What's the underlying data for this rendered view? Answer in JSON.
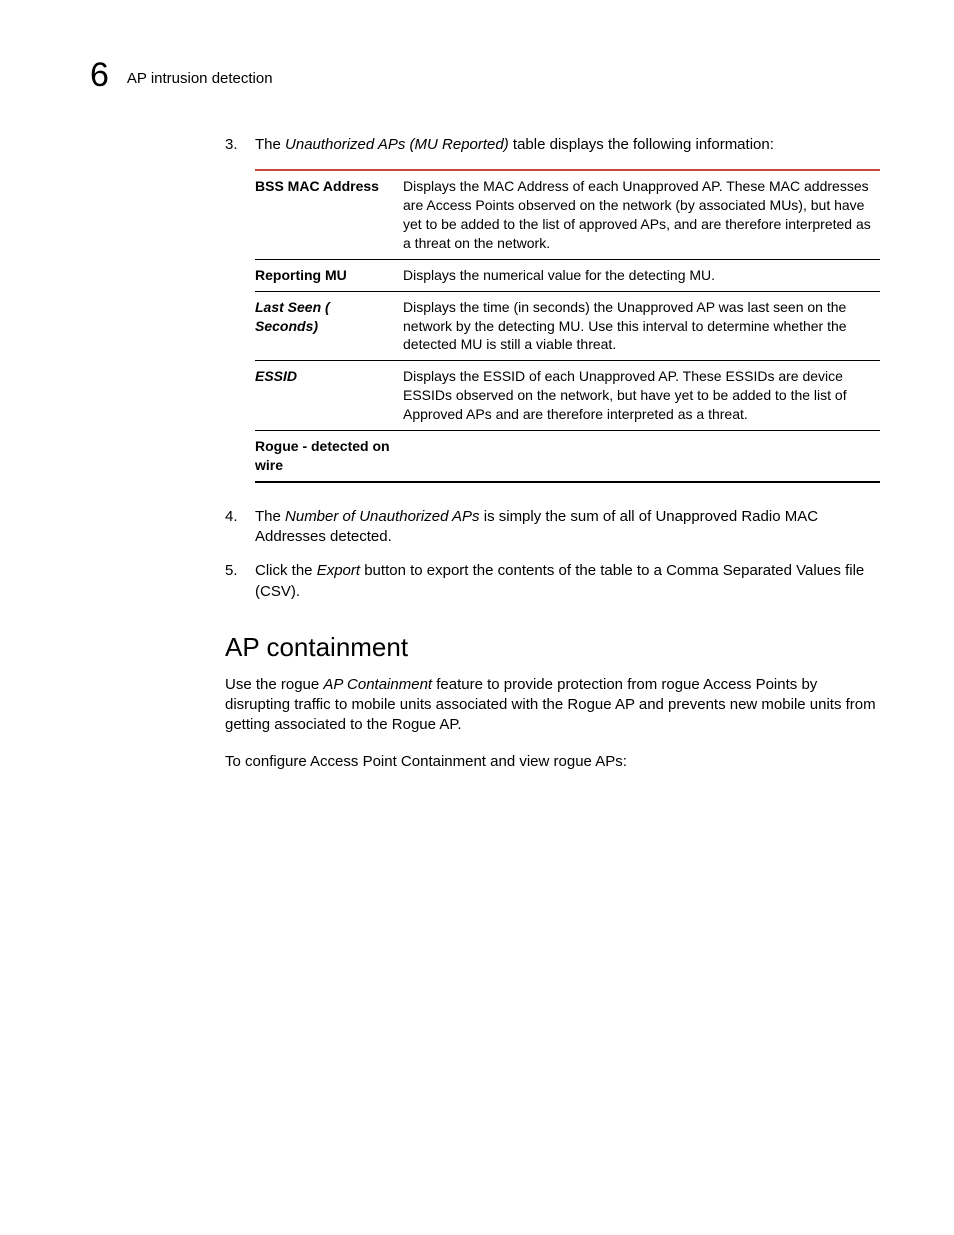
{
  "header": {
    "chapter": "6",
    "title": "AP intrusion detection"
  },
  "steps_a": [
    {
      "num": "3.",
      "pre": "The ",
      "ital": "Unauthorized APs (MU Reported)",
      "post": " table displays the following information:"
    }
  ],
  "table": [
    {
      "term": "BSS MAC Address",
      "term_italic": false,
      "desc": "Displays the MAC Address of each Unapproved AP. These MAC addresses are Access Points observed on the network (by associated MUs), but have yet to be added to the list of approved APs, and are therefore interpreted as a threat on the network."
    },
    {
      "term": "Reporting MU",
      "term_italic": false,
      "desc": "Displays the numerical value for the detecting MU."
    },
    {
      "term": "Last Seen ( Seconds)",
      "term_italic": true,
      "desc": "Displays the time (in seconds) the Unapproved AP was last seen on the network by the detecting MU. Use this interval to determine whether the detected MU is still a viable threat."
    },
    {
      "term": "ESSID",
      "term_italic": true,
      "desc": "Displays the ESSID of each Unapproved AP. These ESSIDs are device ESSIDs observed on the network, but have yet to be added to the list of Approved APs and are therefore interpreted as a threat."
    },
    {
      "term": "Rogue - detected on wire",
      "term_italic": false,
      "desc": ""
    }
  ],
  "steps_b": [
    {
      "num": "4.",
      "pre": "The ",
      "ital": "Number of Unauthorized APs",
      "post": " is simply the sum of all of Unapproved Radio MAC Addresses detected."
    },
    {
      "num": "5.",
      "pre": "Click the ",
      "ital": "Export",
      "post": " button to export the contents of the table to a Comma Separated Values file (CSV)."
    }
  ],
  "section": {
    "heading": "AP containment",
    "p1_pre": "Use the rogue ",
    "p1_ital": "AP Containment",
    "p1_post": " feature to provide protection from rogue Access Points by disrupting traffic to mobile units associated with the Rogue AP and prevents new mobile units from getting associated to the Rogue AP.",
    "p2": "To configure Access Point Containment and view rogue APs:"
  }
}
